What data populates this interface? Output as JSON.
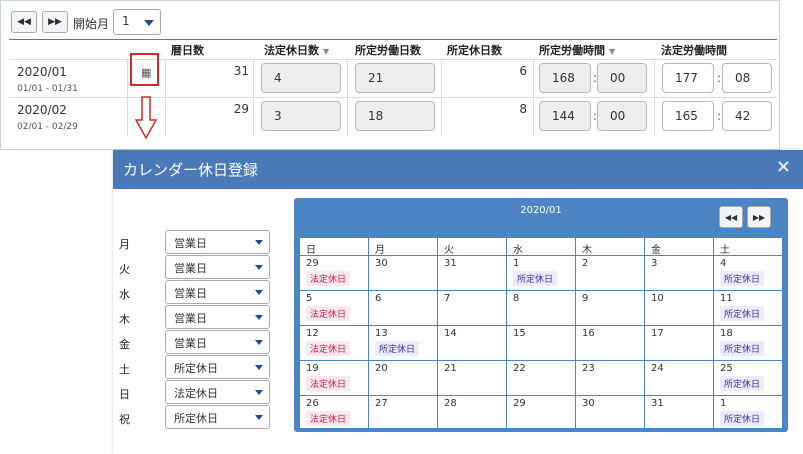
{
  "toolbar": {
    "start_label": "開始月",
    "month_value": "1"
  },
  "table": {
    "headers": {
      "days": "暦日数",
      "legal_holidays": "法定休日数",
      "prescribed_workdays": "所定労働日数",
      "prescribed_holidays": "所定休日数",
      "prescribed_hours": "所定労働時間",
      "legal_hours": "法定労働時間"
    },
    "rows": [
      {
        "ym": "2020/01",
        "range": "01/01 - 01/31",
        "days": "31",
        "legal": "4",
        "work": "21",
        "holi": "6",
        "ph_h": "168",
        "ph_m": "00",
        "lh_h": "177",
        "lh_m": "08"
      },
      {
        "ym": "2020/02",
        "range": "02/01 - 02/29",
        "days": "29",
        "legal": "3",
        "work": "18",
        "holi": "8",
        "ph_h": "144",
        "ph_m": "00",
        "lh_h": "165",
        "lh_m": "42"
      }
    ]
  },
  "modal": {
    "title": "カレンダー休日登録",
    "close": "×",
    "weekday_settings": [
      {
        "label": "月",
        "value": "営業日"
      },
      {
        "label": "火",
        "value": "営業日"
      },
      {
        "label": "水",
        "value": "営業日"
      },
      {
        "label": "木",
        "value": "営業日"
      },
      {
        "label": "金",
        "value": "営業日"
      },
      {
        "label": "土",
        "value": "所定休日"
      },
      {
        "label": "日",
        "value": "法定休日"
      },
      {
        "label": "祝",
        "value": "所定休日"
      }
    ],
    "calendar": {
      "title": "2020/01",
      "weekdays": [
        "日",
        "月",
        "火",
        "水",
        "木",
        "金",
        "土"
      ],
      "weeks": [
        [
          [
            "29",
            "法定休日",
            "legal"
          ],
          [
            "30",
            "",
            ""
          ],
          [
            "31",
            "",
            ""
          ],
          [
            "1",
            "所定休日",
            "prescribed"
          ],
          [
            "2",
            "",
            ""
          ],
          [
            "3",
            "",
            ""
          ],
          [
            "4",
            "所定休日",
            "prescribed"
          ]
        ],
        [
          [
            "5",
            "法定休日",
            "legal"
          ],
          [
            "6",
            "",
            ""
          ],
          [
            "7",
            "",
            ""
          ],
          [
            "8",
            "",
            ""
          ],
          [
            "9",
            "",
            ""
          ],
          [
            "10",
            "",
            ""
          ],
          [
            "11",
            "所定休日",
            "prescribed"
          ]
        ],
        [
          [
            "12",
            "法定休日",
            "legal"
          ],
          [
            "13",
            "所定休日",
            "prescribed"
          ],
          [
            "14",
            "",
            ""
          ],
          [
            "15",
            "",
            ""
          ],
          [
            "16",
            "",
            ""
          ],
          [
            "17",
            "",
            ""
          ],
          [
            "18",
            "所定休日",
            "prescribed"
          ]
        ],
        [
          [
            "19",
            "法定休日",
            "legal"
          ],
          [
            "20",
            "",
            ""
          ],
          [
            "21",
            "",
            ""
          ],
          [
            "22",
            "",
            ""
          ],
          [
            "23",
            "",
            ""
          ],
          [
            "24",
            "",
            ""
          ],
          [
            "25",
            "所定休日",
            "prescribed"
          ]
        ],
        [
          [
            "26",
            "法定休日",
            "legal"
          ],
          [
            "27",
            "",
            ""
          ],
          [
            "28",
            "",
            ""
          ],
          [
            "29",
            "",
            ""
          ],
          [
            "30",
            "",
            ""
          ],
          [
            "31",
            "",
            ""
          ],
          [
            "1",
            "所定休日",
            "prescribed"
          ]
        ]
      ]
    }
  }
}
